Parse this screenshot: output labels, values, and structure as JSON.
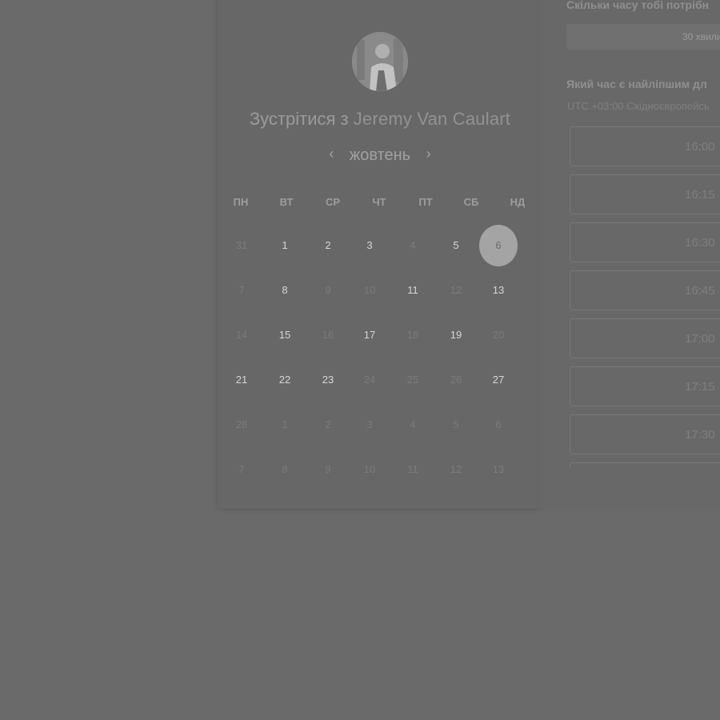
{
  "header": {
    "title_prefix": "Зустрітися з",
    "host_name": "Jeremy Van Caulart"
  },
  "calendar": {
    "month": "жовтень",
    "prev_icon": "chevron-left-icon",
    "next_icon": "chevron-right-icon",
    "weekdays": [
      "ПН",
      "ВТ",
      "СР",
      "ЧТ",
      "ПТ",
      "СБ",
      "НД"
    ],
    "weeks": [
      [
        {
          "d": "31",
          "available": false
        },
        {
          "d": "1",
          "available": true
        },
        {
          "d": "2",
          "available": true
        },
        {
          "d": "3",
          "available": true
        },
        {
          "d": "4",
          "available": false
        },
        {
          "d": "5",
          "available": true
        },
        {
          "d": "6",
          "available": true,
          "selected": true
        }
      ],
      [
        {
          "d": "7",
          "available": false
        },
        {
          "d": "8",
          "available": true
        },
        {
          "d": "9",
          "available": false
        },
        {
          "d": "10",
          "available": false
        },
        {
          "d": "11",
          "available": true
        },
        {
          "d": "12",
          "available": false
        },
        {
          "d": "13",
          "available": true
        }
      ],
      [
        {
          "d": "14",
          "available": false
        },
        {
          "d": "15",
          "available": true
        },
        {
          "d": "16",
          "available": false
        },
        {
          "d": "17",
          "available": true
        },
        {
          "d": "18",
          "available": false
        },
        {
          "d": "19",
          "available": true
        },
        {
          "d": "20",
          "available": false
        }
      ],
      [
        {
          "d": "21",
          "available": true
        },
        {
          "d": "22",
          "available": true
        },
        {
          "d": "23",
          "available": true
        },
        {
          "d": "24",
          "available": false
        },
        {
          "d": "25",
          "available": false
        },
        {
          "d": "26",
          "available": false
        },
        {
          "d": "27",
          "available": true
        }
      ],
      [
        {
          "d": "28",
          "available": false
        },
        {
          "d": "1",
          "available": false
        },
        {
          "d": "2",
          "available": false
        },
        {
          "d": "3",
          "available": false
        },
        {
          "d": "4",
          "available": false
        },
        {
          "d": "5",
          "available": false
        },
        {
          "d": "6",
          "available": false
        }
      ],
      [
        {
          "d": "7",
          "available": false
        },
        {
          "d": "8",
          "available": false
        },
        {
          "d": "9",
          "available": false
        },
        {
          "d": "10",
          "available": false
        },
        {
          "d": "11",
          "available": false
        },
        {
          "d": "12",
          "available": false
        },
        {
          "d": "13",
          "available": false
        }
      ]
    ]
  },
  "booking": {
    "duration_question": "Скільки часу тобі потрібн",
    "duration_value": "30 хвили",
    "time_question": "Який час є найліпшим дл",
    "timezone": "UTC +03:00 Східноєвропейсь",
    "slots": [
      "16:00",
      "16:15",
      "16:30",
      "16:45",
      "17:00",
      "17:15",
      "17:30"
    ]
  }
}
